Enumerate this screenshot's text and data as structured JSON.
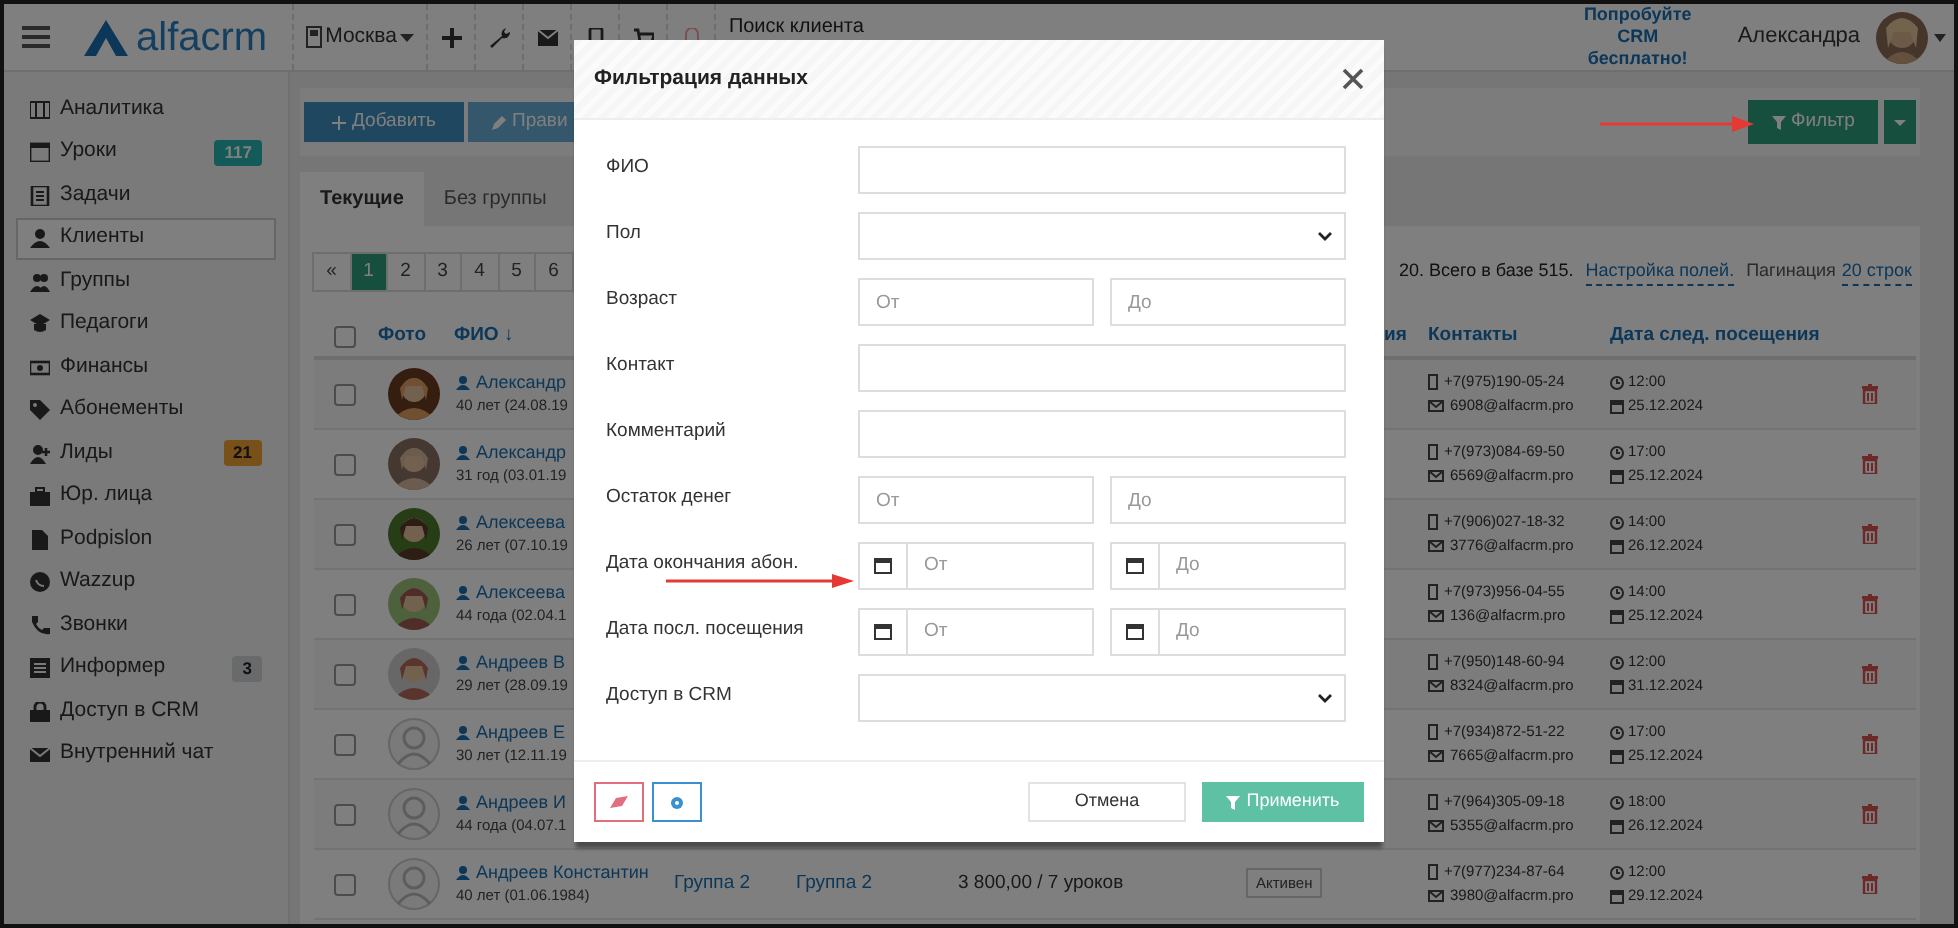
{
  "header": {
    "logo": "alfacrm",
    "branch": "Москва",
    "search_placeholder": "Поиск клиента",
    "promo": "Попробуйте CRM бесплатно!",
    "user": "Александра"
  },
  "sidebar": {
    "items": [
      {
        "label": "Аналитика",
        "selected": false
      },
      {
        "label": "Уроки",
        "selected": false,
        "badge": "117",
        "color": "#135a58"
      },
      {
        "label": "Задачи",
        "selected": false
      },
      {
        "label": "Клиенты",
        "selected": true
      },
      {
        "label": "Группы",
        "selected": false
      },
      {
        "label": "Педагоги",
        "selected": false
      },
      {
        "label": "Финансы",
        "selected": false
      },
      {
        "label": "Абонементы",
        "selected": false
      },
      {
        "label": "Лиды",
        "selected": false,
        "badge": "21",
        "color": "#78501a"
      },
      {
        "label": "Юр. лица",
        "selected": false
      },
      {
        "label": "Podpislon",
        "selected": false
      },
      {
        "label": "Wazzup",
        "selected": false
      },
      {
        "label": "Звонки",
        "selected": false
      },
      {
        "label": "Информер",
        "selected": false,
        "badge": "3",
        "color": "#686a6c"
      },
      {
        "label": "Доступ в CRM",
        "selected": false
      },
      {
        "label": "Внутренний чат",
        "selected": false
      }
    ]
  },
  "toolbar": {
    "buttons": [
      {
        "label": "Добавить",
        "kind": "add"
      },
      {
        "label": "Прави",
        "kind": "edit"
      }
    ],
    "filter_button": "Фильтр"
  },
  "tabs": [
    {
      "label": "Текущие",
      "selected": true
    },
    {
      "label": "Без группы",
      "selected": false
    }
  ],
  "pagination": {
    "pages": [
      {
        "label": "«",
        "selected": false
      },
      {
        "label": "1",
        "selected": true
      },
      {
        "label": "2",
        "selected": false
      },
      {
        "label": "3",
        "selected": false
      },
      {
        "label": "4",
        "selected": false
      },
      {
        "label": "5",
        "selected": false
      },
      {
        "label": "6",
        "selected": false
      }
    ],
    "summary": "20. Всего в базе 515.",
    "fields_link": "Настройка полей.",
    "pagination_label": "Пагинация",
    "rows_link": "20 строк"
  },
  "table": {
    "all_checked": false,
    "columns": {
      "photo": "Фото",
      "name": "ФИО ↓",
      "column_5": "ия",
      "contacts": "Контакты",
      "next_visit": "Дата след. посещения"
    },
    "rows": [
      {
        "checked": false,
        "name": "Александр",
        "age": "40 лет (24.08.19",
        "phone": "+7(975)190-05-24",
        "email": "6908@alfacrm.pro",
        "time": "12:00",
        "date": "25.12.2024"
      },
      {
        "checked": false,
        "name": "Александр",
        "age": "31 год (03.01.19",
        "phone": "+7(973)084-69-50",
        "email": "6569@alfacrm.pro",
        "time": "17:00",
        "date": "25.12.2024"
      },
      {
        "checked": false,
        "name": "Алексеева",
        "age": "26 лет (07.10.19",
        "phone": "+7(906)027-18-32",
        "email": "3776@alfacrm.pro",
        "time": "14:00",
        "date": "26.12.2024"
      },
      {
        "checked": false,
        "name": "Алексеева",
        "age": "44 года (02.04.1",
        "phone": "+7(973)956-04-55",
        "email": "136@alfacrm.pro",
        "time": "14:00",
        "date": "25.12.2024"
      },
      {
        "checked": false,
        "name": "Андреев В",
        "age": "29 лет (28.09.19",
        "phone": "+7(950)148-60-94",
        "email": "8324@alfacrm.pro",
        "time": "12:00",
        "date": "31.12.2024"
      },
      {
        "kind": "placeholder",
        "checked": false,
        "name": "Андреев Е",
        "age": "30 лет (12.11.19",
        "phone": "+7(934)872-51-22",
        "email": "7665@alfacrm.pro",
        "time": "17:00",
        "date": "25.12.2024"
      },
      {
        "kind": "placeholder",
        "checked": false,
        "name": "Андреев И",
        "age": "44 года (04.07.1",
        "phone": "+7(964)305-09-18",
        "email": "5355@alfacrm.pro",
        "time": "18:00",
        "date": "26.12.2024"
      },
      {
        "kind": "placeholder",
        "checked": false,
        "name": "Андреев Константин",
        "age": "40 лет (01.06.1984)",
        "group_1": "Группа 2",
        "group_2": "Группа 2",
        "balance": "3 800,00 / 7 уроков",
        "status": "Активен",
        "phone": "+7(977)234-87-64",
        "email": "3980@alfacrm.pro",
        "time": "12:00",
        "date": "29.12.2024"
      }
    ]
  },
  "modal": {
    "title": "Фильтрация данных",
    "fields": [
      {
        "label": "ФИО",
        "kind": "text"
      },
      {
        "label": "Пол",
        "kind": "select"
      },
      {
        "label": "Возраст",
        "kind": "range",
        "placeholders": [
          "От",
          "До"
        ]
      },
      {
        "label": "Контакт",
        "kind": "text"
      },
      {
        "label": "Комментарий",
        "kind": "text"
      },
      {
        "label": "Остаток денег",
        "kind": "range",
        "placeholders": [
          "От",
          "До"
        ]
      },
      {
        "label": "Дата окончания абон.",
        "kind": "date_range",
        "placeholders": [
          "От",
          "До"
        ]
      },
      {
        "label": "Дата посл. посещения",
        "kind": "date_range",
        "placeholders": [
          "От",
          "До"
        ]
      },
      {
        "label": "Доступ в CRM",
        "kind": "select"
      }
    ],
    "cancel_button": "Отмена",
    "apply_button": "Применить"
  }
}
